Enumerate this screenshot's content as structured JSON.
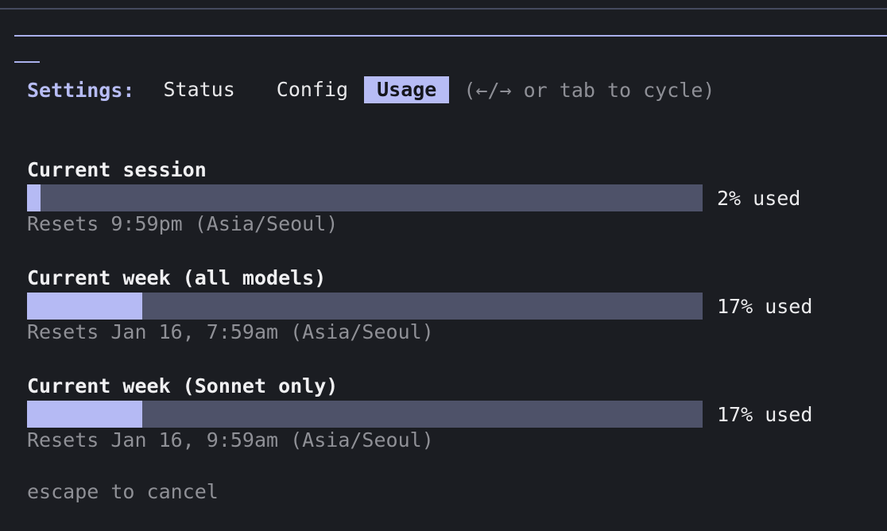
{
  "settings_label": "Settings:",
  "tabs": [
    {
      "label": "Status",
      "active": false
    },
    {
      "label": "Config",
      "active": false
    },
    {
      "label": "Usage",
      "active": true
    }
  ],
  "hint": "(←/→ or tab to cycle)",
  "usage": [
    {
      "title": "Current session",
      "percent": 2,
      "percent_label": "2% used",
      "reset": "Resets 9:59pm (Asia/Seoul)"
    },
    {
      "title": "Current week (all models)",
      "percent": 17,
      "percent_label": "17% used",
      "reset": "Resets Jan 16, 7:59am (Asia/Seoul)"
    },
    {
      "title": "Current week (Sonnet only)",
      "percent": 17,
      "percent_label": "17% used",
      "reset": "Resets Jan 16, 9:59am (Asia/Seoul)"
    }
  ],
  "footer": "escape to cancel",
  "colors": {
    "accent": "#b7bcf5",
    "bar_track": "#4e5269",
    "bar_fill": "#b5baf4",
    "background": "#1b1d22",
    "muted": "#8f9096"
  }
}
